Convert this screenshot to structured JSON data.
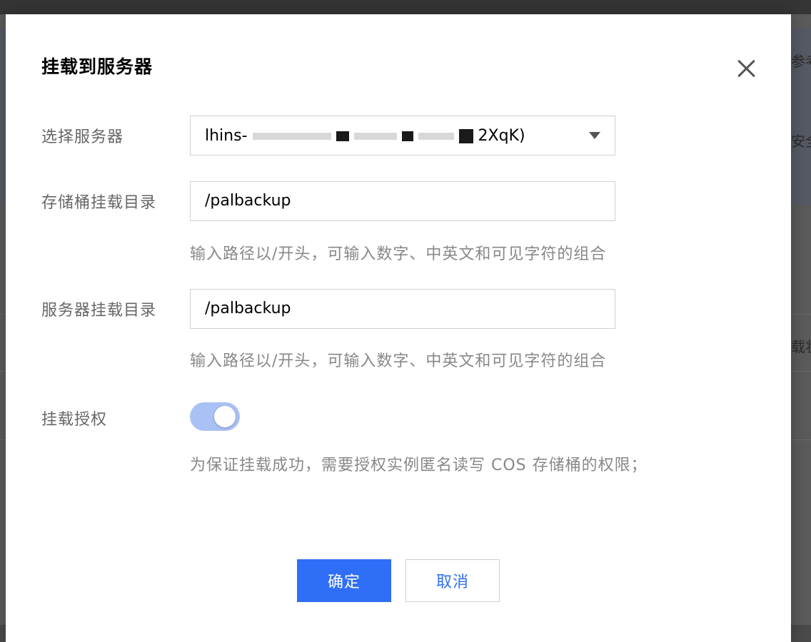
{
  "background": {
    "fragments": [
      "参考",
      "安全",
      "载状"
    ]
  },
  "dialog": {
    "title": "挂载到服务器",
    "close_icon": "close-icon",
    "server": {
      "label": "选择服务器",
      "value_start": "lhins-",
      "value_end": "2XqK)"
    },
    "bucket_dir": {
      "label": "存储桶挂载目录",
      "value": "/palbackup",
      "hint": "输入路径以/开头，可输入数字、中英文和可见字符的组合"
    },
    "server_dir": {
      "label": "服务器挂载目录",
      "value": "/palbackup",
      "hint": "输入路径以/开头，可输入数字、中英文和可见字符的组合"
    },
    "authorize": {
      "label": "挂载授权",
      "enabled": true,
      "hint": "为保证挂载成功，需要授权实例匿名读写 COS 存储桶的权限；"
    },
    "confirm_label": "确定",
    "cancel_label": "取消"
  },
  "colors": {
    "primary": "#2f6ef6",
    "toggle_on": "#a9c1f5"
  }
}
